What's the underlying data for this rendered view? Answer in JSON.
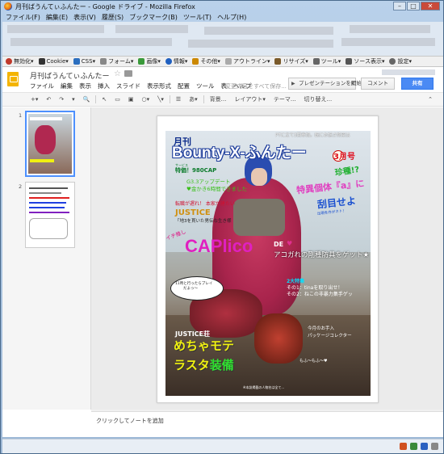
{
  "window": {
    "title": "月刊ばうんてぃふんたー - Google ドライブ - Mozilla Firefox",
    "controls": {
      "minimize": "–",
      "maximize": "□",
      "close": "✕"
    }
  },
  "menubar": [
    "ファイル(F)",
    "編集(E)",
    "表示(V)",
    "履歴(S)",
    "ブックマーク(B)",
    "ツール(T)",
    "ヘルプ(H)"
  ],
  "addonbar": {
    "items": [
      {
        "label": "無効化▾",
        "color": "#c0392b"
      },
      {
        "label": "Cookie▾",
        "color": "#333333"
      },
      {
        "label": "CSS▾",
        "color": "#2c6fbf"
      },
      {
        "label": "フォーム▾",
        "color": "#888888"
      },
      {
        "label": "画像▾",
        "color": "#3a9a3a"
      },
      {
        "label": "情報▾",
        "color": "#2060c0"
      },
      {
        "label": "その他▾",
        "color": "#cc8800"
      },
      {
        "label": "アウトライン▾",
        "color": "#aaaaaa"
      },
      {
        "label": "リサイズ▾",
        "color": "#7a5a2a"
      },
      {
        "label": "ツール▾",
        "color": "#666666"
      },
      {
        "label": "ソース表示▾",
        "color": "#555555"
      },
      {
        "label": "設定▾",
        "color": "#666666"
      }
    ]
  },
  "docs": {
    "title": "月刊ばうんてぃふんたー",
    "menu": [
      "ファイル",
      "編集",
      "表示",
      "挿入",
      "スライド",
      "表示形式",
      "配置",
      "ツール",
      "表",
      "ヘルプ"
    ],
    "status": "変更内容をすべて保存...",
    "present_label": "プレゼンテーションを開始",
    "comment_label": "コメント",
    "share_label": "共有",
    "toolbar": [
      "+▾",
      "↶",
      "↷",
      "▾",
      "🔍",
      "↖",
      "▭",
      "▣",
      "○▾",
      "╲▾",
      "☰",
      "あ▾",
      "背景...",
      "レイアウト▾",
      "テーマ...",
      "切り替え...",
      "⌃"
    ],
    "slides": [
      "1",
      "2"
    ],
    "notes_placeholder": "クリックしてノートを追加"
  },
  "cover": {
    "gekkan": "月刊",
    "title": "Bounty-X-ふんたー",
    "top_note": "PTに立て5回参加。既にお話さ終臣は",
    "month": "3月号",
    "service_kana": "サービス",
    "service": "特価！980CAP",
    "g33_line1": "G3.3アップデート",
    "g33_line2": "♥金かき6時間できました",
    "lead": "転職が遅れ！ 本家が建たい",
    "justice": "JUSTICE",
    "sub": "「地3を貫いた男伝な生き様",
    "chinshu": "珍種!?",
    "tokui": "特異個体『a』に",
    "toku2": "刮目せよ",
    "smallnote": "出現条件がネト！",
    "ichioshi": "イチ推し",
    "caplico": "CAPlico",
    "de": "DE",
    "heart": "♥",
    "akogare": "アコガれの剛種防具をゲット★",
    "two_title": "2大特集",
    "two_1": "その1：tinaを取り出せ！",
    "two_2": "その2：ねこの非暴力集手ゲッ",
    "bubble_1": "11時と行ったらプレイ",
    "bubble_2": "だよっ～",
    "justice2": "JUSTICE荘",
    "mecha": "めちゃモテ",
    "rasta": "ラスタ",
    "rasta_green": "装備",
    "kongetsu": "今月のお手入",
    "package": "パッケージコレクター",
    "mofumofu": "もふ～もふ～♥",
    "bottom": "※本誌掲載の人物名は全て..."
  },
  "colors": {
    "accent_blue": "#4a8af4",
    "logo_yellow": "#f4b400",
    "selection": "#4d90fe"
  }
}
